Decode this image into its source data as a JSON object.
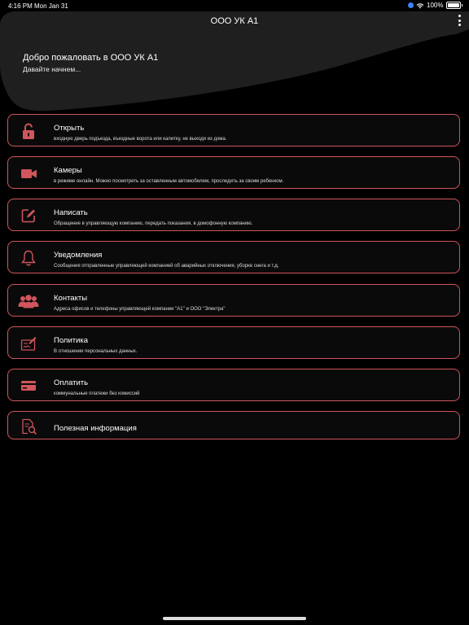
{
  "status": {
    "time": "4:16 PM",
    "date": "Mon Jan 31",
    "battery": "100%"
  },
  "header": {
    "title": "ООО УК А1",
    "welcome": "Добро пожаловать в ООО УК А1",
    "subtitle": "Давайте начнем..."
  },
  "colors": {
    "accent": "#d0555c",
    "background": "#000000",
    "card": "#1f1f1f"
  },
  "items": [
    {
      "icon": "lock-icon",
      "title": "Открыть",
      "desc": "входную дверь подъезда, въездные ворота или калитку, не выходя из дома."
    },
    {
      "icon": "video-camera-icon",
      "title": "Камеры",
      "desc": "в режиме онлайн. Можно посмотреть за оставленным автомобилем, проследить за своим ребенком."
    },
    {
      "icon": "edit-icon",
      "title": "Написать",
      "desc": "Обращение в управляющую компанию, передать показания, в домофонную компанию."
    },
    {
      "icon": "bell-icon",
      "title": "Уведомления",
      "desc": "Сообщения отправленные управляющей компанией об аварийных отключения, уборке снега и т.д."
    },
    {
      "icon": "users-icon",
      "title": "Контакты",
      "desc": "Адреса офисов и телефоны управляющей компании \"А1\" и ООО \"Электра\""
    },
    {
      "icon": "signature-icon",
      "title": "Политика",
      "desc": "В отношении персональных данных."
    },
    {
      "icon": "credit-card-icon",
      "title": "Оплатить",
      "desc": "коммунальные платежи без комиссий"
    },
    {
      "icon": "document-search-icon",
      "title": "Полезная информация",
      "desc": ""
    }
  ]
}
